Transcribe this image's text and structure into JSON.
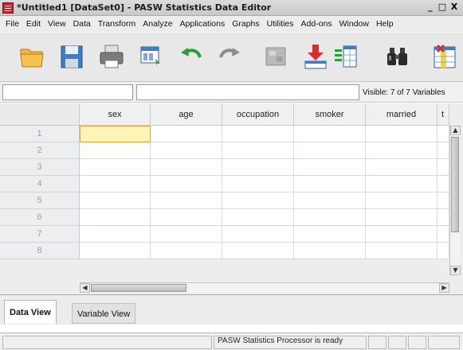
{
  "window": {
    "title": "*Untitled1 [DataSet0] - PASW Statistics Data Editor",
    "controls": [
      "_",
      "□",
      "X"
    ]
  },
  "menu": [
    "File",
    "Edit",
    "View",
    "Data",
    "Transform",
    "Analyze",
    "Applications",
    "Graphs",
    "Utilities",
    "Add-ons",
    "Window",
    "Help"
  ],
  "toolbar": {
    "icons": [
      "open-folder-icon",
      "save-icon",
      "print-icon",
      "dialog-recall-icon",
      "undo-icon",
      "redo-icon",
      "goto-case-icon",
      "insert-cases-icon",
      "variables-icon",
      "find-icon",
      "insert-variable-icon"
    ]
  },
  "infobar": {
    "cell_name": "",
    "cell_value": "",
    "visible": "Visible: 7 of 7 Variables"
  },
  "grid": {
    "columns": [
      "sex",
      "age",
      "occupation",
      "smoker",
      "married",
      "t"
    ],
    "rows": [
      "1",
      "2",
      "3",
      "4",
      "5",
      "6",
      "7",
      "8"
    ],
    "active_cell": {
      "row": 1,
      "column": "sex"
    }
  },
  "tabs": {
    "data_view": "Data View",
    "variable_view": "Variable View"
  },
  "status": {
    "text": "PASW Statistics Processor is ready"
  },
  "colors": {
    "active_cell": "#fff4b8",
    "brand": "#c1272d"
  }
}
